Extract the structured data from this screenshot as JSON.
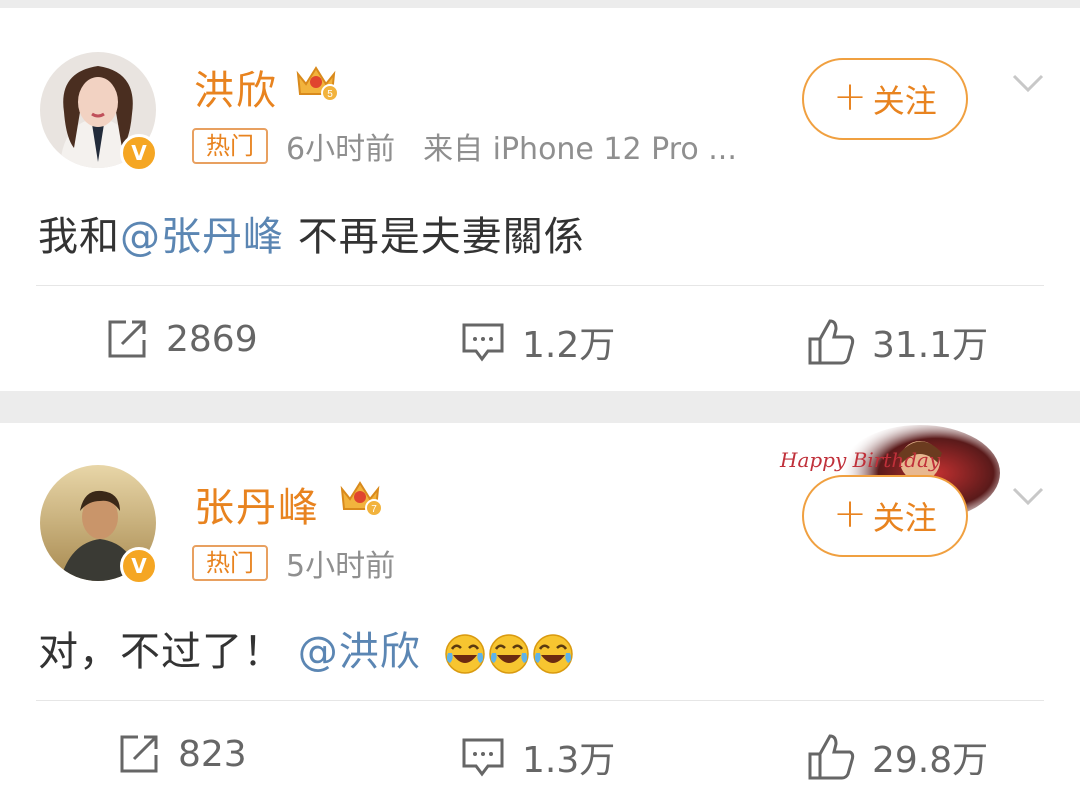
{
  "posts": [
    {
      "username": "洪欣",
      "level": "5",
      "hot_tag": "热门",
      "time": "6小时前",
      "source": "来自 iPhone 12 Pro ...",
      "text_before": "我和",
      "mention": "@张丹峰",
      "text_after": " 不再是夫妻關係",
      "follow_label": "关注",
      "reposts": "2869",
      "comments": "1.2万",
      "likes": "31.1万"
    },
    {
      "username": "张丹峰",
      "level": "7",
      "hot_tag": "热门",
      "time": "5小时前",
      "text_before": "对，不过了！",
      "mention": "@洪欣",
      "decoration_text": "Happy Birthday",
      "follow_label": "关注",
      "reposts": "823",
      "comments": "1.3万",
      "likes": "29.8万"
    }
  ],
  "colors": {
    "accent": "#e8831f",
    "mention": "#5b86b3",
    "verified": "#f5a623"
  },
  "icons": [
    "verified-badge-icon",
    "crown-icon",
    "chevron-down-icon",
    "repost-icon",
    "comment-icon",
    "like-icon",
    "laugh-cry-emoji"
  ]
}
